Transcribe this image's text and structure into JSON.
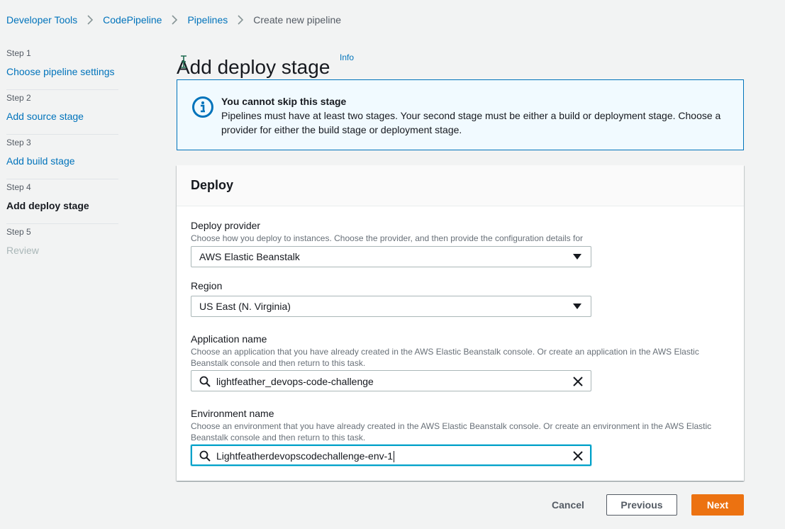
{
  "breadcrumb": {
    "items": [
      "Developer Tools",
      "CodePipeline",
      "Pipelines"
    ],
    "current": "Create new pipeline"
  },
  "steps": [
    {
      "number": "Step 1",
      "label": "Choose pipeline settings",
      "state": "link"
    },
    {
      "number": "Step 2",
      "label": "Add source stage",
      "state": "link"
    },
    {
      "number": "Step 3",
      "label": "Add build stage",
      "state": "link"
    },
    {
      "number": "Step 4",
      "label": "Add deploy stage",
      "state": "active"
    },
    {
      "number": "Step 5",
      "label": "Review",
      "state": "disabled"
    }
  ],
  "page": {
    "title": "Add deploy stage",
    "info": "Info"
  },
  "alert": {
    "title": "You cannot skip this stage",
    "body": "Pipelines must have at least two stages. Your second stage must be either a build or deployment stage. Choose a provider for either the build stage or deployment stage."
  },
  "deploy": {
    "title": "Deploy",
    "provider": {
      "label": "Deploy provider",
      "description": "Choose how you deploy to instances. Choose the provider, and then provide the configuration details for that provider.",
      "value": "AWS Elastic Beanstalk"
    },
    "region": {
      "label": "Region",
      "value": "US East (N. Virginia)"
    },
    "application": {
      "label": "Application name",
      "description": "Choose an application that you have already created in the AWS Elastic Beanstalk console. Or create an application in the AWS Elastic Beanstalk console and then return to this task.",
      "value": "lightfeather_devops-code-challenge"
    },
    "environment": {
      "label": "Environment name",
      "description": "Choose an environment that you have already created in the AWS Elastic Beanstalk console. Or create an environment in the AWS Elastic Beanstalk console and then return to this task.",
      "value": "Lightfeatherdevopscodechallenge-env-1"
    }
  },
  "footer": {
    "cancel": "Cancel",
    "previous": "Previous",
    "next": "Next"
  },
  "colors": {
    "link": "#0073bb",
    "primary": "#ec7211",
    "focus": "#00a1c9",
    "alert_bg": "#f1faff"
  },
  "icons": [
    "chevron-right-icon",
    "info-circle-icon",
    "caret-down-icon",
    "search-icon",
    "close-icon",
    "text-cursor-icon"
  ]
}
